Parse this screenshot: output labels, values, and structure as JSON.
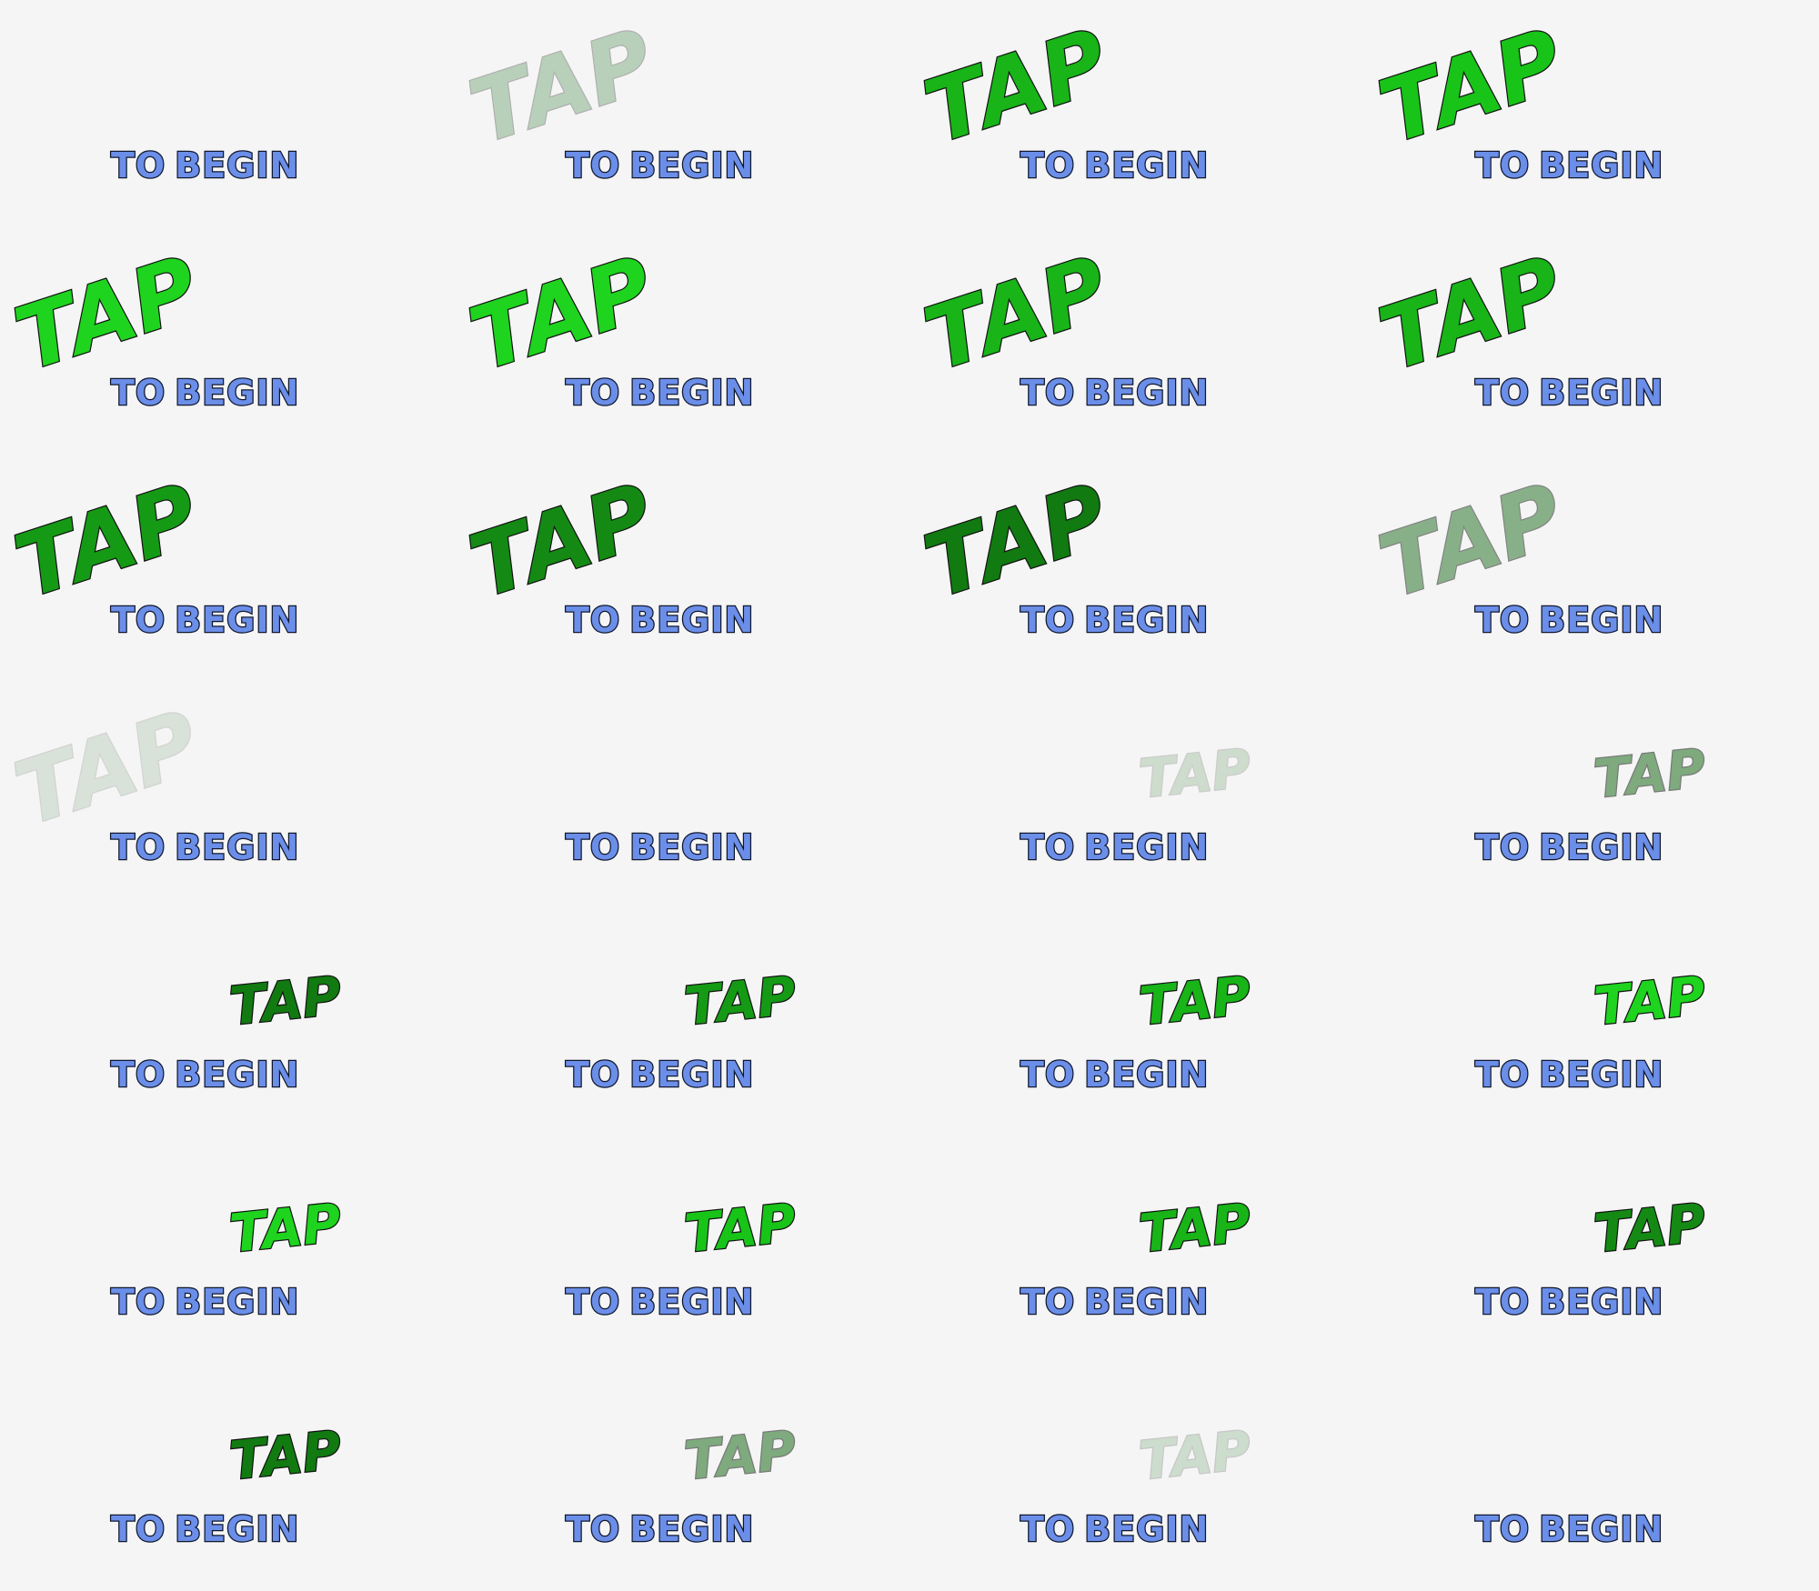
{
  "screen": {
    "prompt_word": "TAP",
    "prompt_line_to": "TO",
    "prompt_line_begin": "BEGIN",
    "background_color": "#f5f5f5",
    "begin_text_color": "#6b8ee8",
    "outline_color": "#10182e",
    "columns": 4
  },
  "frames": [
    {
      "tap_style": "hidden",
      "tap_opacity": 0,
      "tap_color": "#18c418"
    },
    {
      "tap_style": "large",
      "tap_opacity": 0.3,
      "tap_color": "#2e7d32"
    },
    {
      "tap_style": "large",
      "tap_opacity": 1,
      "tap_color": "#18b418"
    },
    {
      "tap_style": "large",
      "tap_opacity": 1,
      "tap_color": "#18c418"
    },
    {
      "tap_style": "large",
      "tap_opacity": 1,
      "tap_color": "#1ed41e"
    },
    {
      "tap_style": "large",
      "tap_opacity": 1,
      "tap_color": "#1ed41e"
    },
    {
      "tap_style": "large",
      "tap_opacity": 1,
      "tap_color": "#18b418"
    },
    {
      "tap_style": "large",
      "tap_opacity": 1,
      "tap_color": "#18b418"
    },
    {
      "tap_style": "large",
      "tap_opacity": 1,
      "tap_color": "#159a15"
    },
    {
      "tap_style": "large",
      "tap_opacity": 1,
      "tap_color": "#148a14"
    },
    {
      "tap_style": "large",
      "tap_opacity": 1,
      "tap_color": "#117a11"
    },
    {
      "tap_style": "large",
      "tap_opacity": 0.5,
      "tap_color": "#1e6e1e"
    },
    {
      "tap_style": "large",
      "tap_opacity": 0.15,
      "tap_color": "#3c7a3c"
    },
    {
      "tap_style": "hidden",
      "tap_opacity": 0,
      "tap_color": "#18c418"
    },
    {
      "tap_style": "small",
      "tap_opacity": 0.18,
      "tap_color": "#1e6e1e"
    },
    {
      "tap_style": "small",
      "tap_opacity": 0.55,
      "tap_color": "#1e6e1e"
    },
    {
      "tap_style": "small",
      "tap_opacity": 1,
      "tap_color": "#117a11"
    },
    {
      "tap_style": "small",
      "tap_opacity": 1,
      "tap_color": "#159a15"
    },
    {
      "tap_style": "small",
      "tap_opacity": 1,
      "tap_color": "#18b418"
    },
    {
      "tap_style": "small",
      "tap_opacity": 1,
      "tap_color": "#1ed41e"
    },
    {
      "tap_style": "small",
      "tap_opacity": 1,
      "tap_color": "#1ed41e"
    },
    {
      "tap_style": "small",
      "tap_opacity": 1,
      "tap_color": "#18c418"
    },
    {
      "tap_style": "small",
      "tap_opacity": 1,
      "tap_color": "#18b418"
    },
    {
      "tap_style": "small",
      "tap_opacity": 1,
      "tap_color": "#148a14"
    },
    {
      "tap_style": "small",
      "tap_opacity": 1,
      "tap_color": "#117a11"
    },
    {
      "tap_style": "small",
      "tap_opacity": 0.55,
      "tap_color": "#1e6e1e"
    },
    {
      "tap_style": "small",
      "tap_opacity": 0.2,
      "tap_color": "#2e7d32"
    },
    {
      "tap_style": "hidden",
      "tap_opacity": 0,
      "tap_color": "#18c418"
    }
  ]
}
